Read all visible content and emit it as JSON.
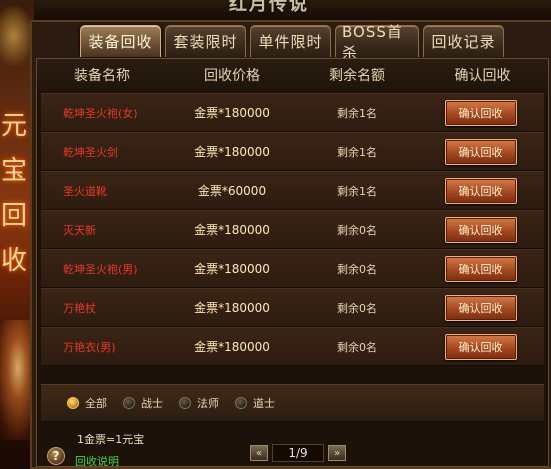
{
  "header_art": "红月传说",
  "side_art": [
    "元",
    "宝",
    "回",
    "收"
  ],
  "tabs": [
    {
      "label": "装备回收",
      "active": true
    },
    {
      "label": "套装限时",
      "active": false
    },
    {
      "label": "单件限时",
      "active": false
    },
    {
      "label": "BOSS首杀",
      "active": false
    },
    {
      "label": "回收记录",
      "active": false
    }
  ],
  "columns": [
    "装备名称",
    "回收价格",
    "剩余名额",
    "确认回收"
  ],
  "rows": [
    {
      "name": "乾坤圣火袍(女)",
      "price": "金票*180000",
      "remaining": "剩余1名",
      "action": "确认回收"
    },
    {
      "name": "乾坤圣火剑",
      "price": "金票*180000",
      "remaining": "剩余1名",
      "action": "确认回收"
    },
    {
      "name": "圣火道靴",
      "price": "金票*60000",
      "remaining": "剩余1名",
      "action": "确认回收"
    },
    {
      "name": "灭天新",
      "price": "金票*180000",
      "remaining": "剩余0名",
      "action": "确认回收"
    },
    {
      "name": "乾坤圣火袍(男)",
      "price": "金票*180000",
      "remaining": "剩余0名",
      "action": "确认回收"
    },
    {
      "name": "万艳杖",
      "price": "金票*180000",
      "remaining": "剩余0名",
      "action": "确认回收"
    },
    {
      "name": "万艳衣(男)",
      "price": "金票*180000",
      "remaining": "剩余0名",
      "action": "确认回收"
    }
  ],
  "filters": [
    {
      "label": "全部",
      "selected": true
    },
    {
      "label": "战士",
      "selected": false
    },
    {
      "label": "法师",
      "selected": false
    },
    {
      "label": "道士",
      "selected": false
    }
  ],
  "footer": {
    "rate": "1金票=1元宝",
    "help_link": "回收说明",
    "help_icon": "?",
    "prev": "«",
    "next": "»",
    "page": "1/9"
  },
  "colors": {
    "item_name": "#e63a28",
    "help_link": "#4cd24c",
    "button": "#a44820"
  }
}
